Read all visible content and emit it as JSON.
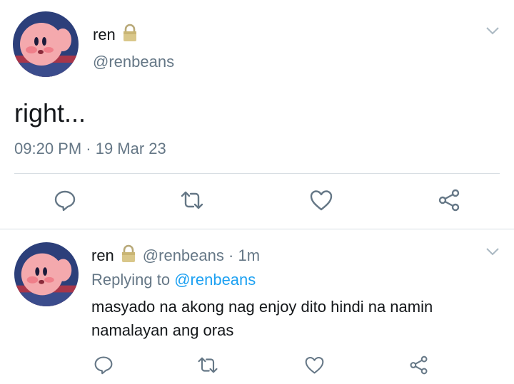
{
  "main_tweet": {
    "name": "ren",
    "handle": "@renbeans",
    "text": "right...",
    "timestamp": "09:20 PM · 19 Mar 23"
  },
  "reply": {
    "name": "ren",
    "handle": "@renbeans",
    "separator": "·",
    "age": "1m",
    "replying_prefix": "Replying to",
    "replying_to": "@renbeans",
    "text": "masyado na akong nag enjoy dito hindi na namin namalayan ang oras"
  },
  "icons": {
    "lock": "lock-icon",
    "menu": "chevron-down-icon",
    "actions": [
      "reply-icon",
      "retweet-icon",
      "like-icon",
      "share-icon"
    ]
  },
  "colors": {
    "text_primary": "#14171a",
    "text_secondary": "#657786",
    "link": "#1da1f2",
    "icon": "#657786",
    "divider": "#d8dee3"
  }
}
